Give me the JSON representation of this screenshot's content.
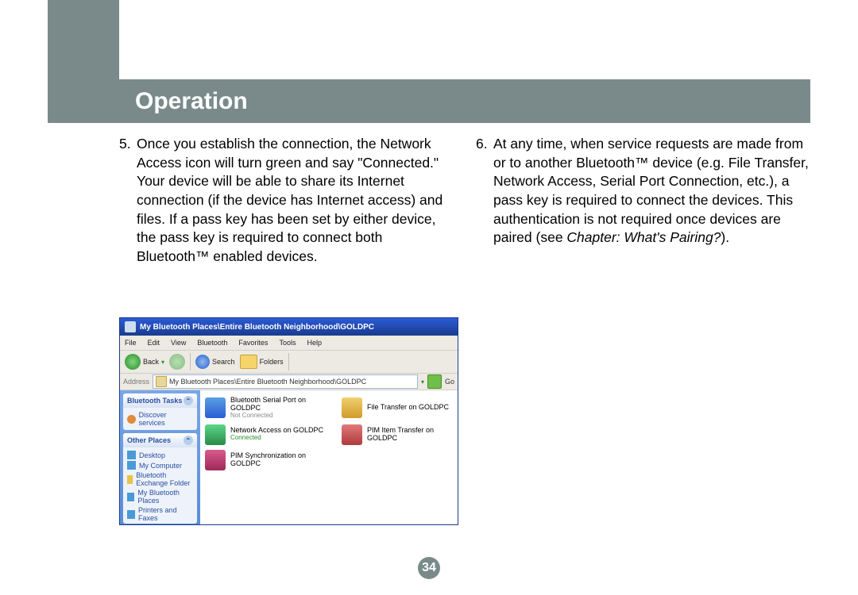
{
  "header": {
    "title": "Operation"
  },
  "columns": {
    "left": {
      "num": "5.",
      "text": "Once you establish the connection, the Network Access icon will turn green and say \"Connected.\" Your device will be able to share its Internet connection (if the device has Internet access) and files. If a pass key has been set by either device, the pass key is required to connect both Bluetooth™ enabled devices."
    },
    "right": {
      "num": "6.",
      "text_part1": "At any time, when service requests are made from or to another Bluetooth™ device (e.g. File Transfer, Network Access, Serial Port Connection, etc.), a pass key is required to connect the devices. This authentication is not required once devices are paired (see ",
      "text_italic": "Chapter: What's Pairing?",
      "text_part2": ")."
    }
  },
  "window": {
    "title": "My Bluetooth Places\\Entire Bluetooth Neighborhood\\GOLDPC",
    "menu": [
      "File",
      "Edit",
      "View",
      "Bluetooth",
      "Favorites",
      "Tools",
      "Help"
    ],
    "toolbar": {
      "back": "Back",
      "search": "Search",
      "folders": "Folders"
    },
    "address": {
      "label": "Address",
      "value": "My Bluetooth Places\\Entire Bluetooth Neighborhood\\GOLDPC",
      "go": "Go"
    },
    "sidebar": {
      "panel1": {
        "title": "Bluetooth Tasks",
        "links": [
          "Discover services"
        ]
      },
      "panel2": {
        "title": "Other Places",
        "links": [
          "Desktop",
          "My Computer",
          "Bluetooth Exchange Folder",
          "My Bluetooth Places",
          "Printers and Faxes"
        ]
      }
    },
    "services": {
      "s1": {
        "name": "Bluetooth Serial Port on GOLDPC",
        "sub": "Not Connected"
      },
      "s2": {
        "name": "File Transfer on GOLDPC"
      },
      "s3": {
        "name": "Network Access on GOLDPC",
        "sub": "Connected"
      },
      "s4": {
        "name": "PIM Item Transfer on GOLDPC"
      },
      "s5": {
        "name": "PIM Synchronization on GOLDPC"
      }
    }
  },
  "page_number": "34"
}
